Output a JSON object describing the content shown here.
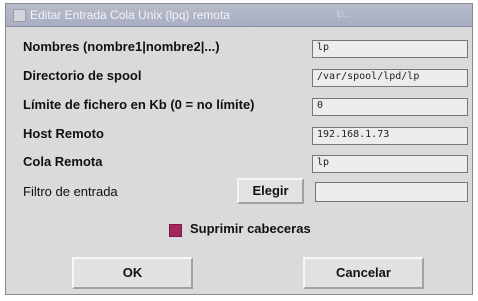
{
  "window": {
    "title": "Editar Entrada Cola Unix (lpq) remota",
    "title_extra": "lp..."
  },
  "rows": [
    {
      "label": "Nombres (nombre1|nombre2|...)",
      "value": "lp"
    },
    {
      "label": "Directorio de spool",
      "value": "/var/spool/lpd/lp"
    },
    {
      "label": "Límite de fichero en Kb (0 = no límite)",
      "value": "0"
    },
    {
      "label": "Host Remoto",
      "value": "192.168.1.73"
    },
    {
      "label": "Cola Remota",
      "value": "lp"
    }
  ],
  "filter": {
    "label": "Filtro de entrada",
    "button_label": "Elegir",
    "value": ""
  },
  "option": {
    "label": "Suprimir cabeceras",
    "checked": true
  },
  "buttons": {
    "ok": "OK",
    "cancel": "Cancelar"
  }
}
